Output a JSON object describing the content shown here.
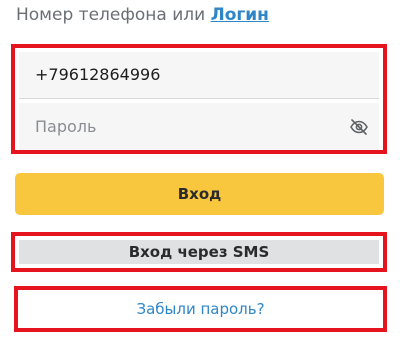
{
  "header": {
    "label": "Номер телефона или",
    "link": "Логин"
  },
  "form": {
    "phone_value": "+79612864996",
    "password_placeholder": "Пароль",
    "password_toggle_icon": "eye-slash-icon"
  },
  "buttons": {
    "login": "Вход",
    "sms_login": "Вход через SMS",
    "forgot_password": "Забыли пароль?"
  },
  "colors": {
    "accent_yellow": "#f9c73e",
    "link_blue": "#2e86c8",
    "highlight_red": "#e5141f",
    "sms_button_gray": "#e0e1e3"
  }
}
